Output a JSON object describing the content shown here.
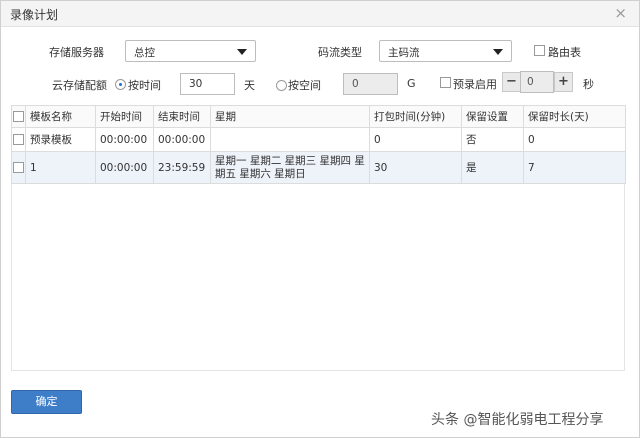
{
  "dialog": {
    "title": "录像计划",
    "close_glyph": "×"
  },
  "form": {
    "storage_server_label": "存储服务器",
    "storage_server_value": "总控",
    "stream_type_label": "码流类型",
    "stream_type_value": "主码流",
    "route_table_label": "路由表",
    "cloud_quota_label": "云存储配额",
    "by_time_label": "按时间",
    "time_value": "30",
    "day_unit": "天",
    "by_space_label": "按空间",
    "space_value": "0",
    "space_unit": "G",
    "prerecord_label": "预录启用",
    "prerecord_minus": "−",
    "prerecord_value": "0",
    "prerecord_plus": "+",
    "prerecord_unit": "秒"
  },
  "table": {
    "columns": [
      "模板名称",
      "开始时间",
      "结束时间",
      "星期",
      "打包时间(分钟)",
      "保留设置",
      "保留时长(天)"
    ],
    "rows": [
      [
        "预录模板",
        "00:00:00",
        "00:00:00",
        "",
        "0",
        "否",
        "0"
      ],
      [
        "1",
        "00:00:00",
        "23:59:59",
        "星期一 星期二 星期三 星期四 星期五 星期六 星期日",
        "30",
        "是",
        "7"
      ]
    ]
  },
  "footer": {
    "ok_label": "确定"
  },
  "watermark": "头条 @智能化弱电工程分享"
}
